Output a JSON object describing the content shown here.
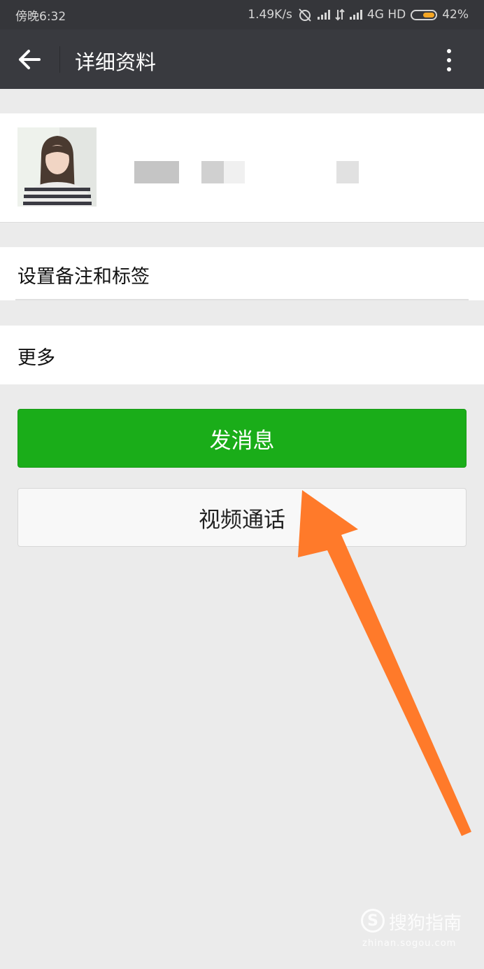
{
  "status_bar": {
    "time": "傍晚6:32",
    "speed": "1.49K/s",
    "network": "4G HD",
    "battery": "42%",
    "battery_color": "#f5a623"
  },
  "header": {
    "title": "详细资料",
    "back_icon": "arrow-left-icon",
    "more_icon": "more-vertical-icon"
  },
  "profile": {
    "avatar": "profile-avatar"
  },
  "menu": {
    "remark_label": "设置备注和标签",
    "more_label": "更多"
  },
  "actions": {
    "send_label": "发消息",
    "video_label": "视频通话",
    "send_color": "#1aad19"
  },
  "annotation": {
    "arrow_color": "#ff7a2a"
  },
  "watermark": {
    "logo": "S",
    "text": "搜狗指南",
    "sub": "zhinan.sogou.com"
  }
}
